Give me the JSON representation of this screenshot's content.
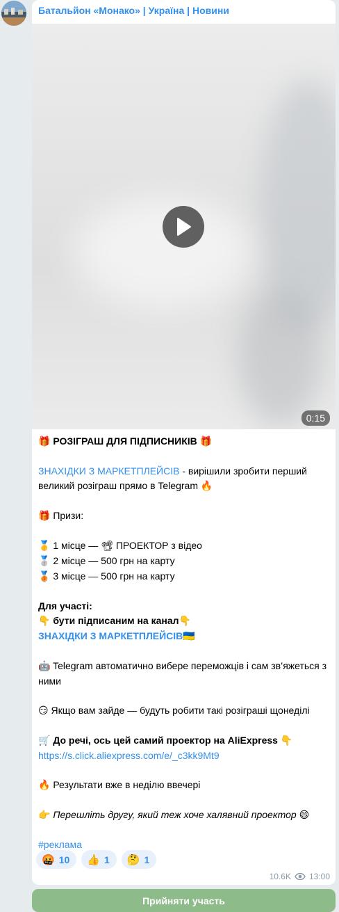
{
  "channel": {
    "title": "Батальйон «Монако» | Україна | Новини"
  },
  "video": {
    "duration": "0:15",
    "play_icon": "play-icon"
  },
  "post": {
    "heading": "РОЗІГРАШ ДЛЯ ПІДПИСНИКІВ",
    "heading_emoji": "🎁",
    "intro_link": "ЗНАХІДКИ З МАРКЕТПЛЕЙСІВ",
    "intro_text": " - вирішили зробити перший великий розіграш прямо в Telegram",
    "intro_emoji": "🔥",
    "prizes_emoji": "🎁",
    "prizes_label": "Призи:",
    "prize1_emoji": "🥇",
    "prize1_text": "1 місце —",
    "prize1_icon": "📽",
    "prize1_item": "ПРОЕКТОР з відео",
    "prize2_emoji": "🥈",
    "prize2_text": "2 місце — 500 грн на карту",
    "prize3_emoji": "🥉",
    "prize3_text": "3 місце — 500 грн на карту",
    "participation_label": "Для участі:",
    "participation_emoji": "👇",
    "participation_text": "бути підписаним на канал",
    "participation_emoji2": "👇",
    "channel_link": "ЗНАХІДКИ З МАРКЕТПЛЕЙСІВ",
    "flag_emoji": "🇺🇦",
    "bot_emoji": "🤖",
    "bot_text": "Telegram автоматично вибере переможців і сам зв’яжеться з ними",
    "smirk_emoji": "😏",
    "weekly_text": "Якщо вам зайде — будуть робити такі розіграші щонеділі",
    "cart_emoji": "🛒",
    "product_text": "До речі, ось цей самий проектор на AliExpress",
    "product_emoji2": "👇",
    "product_url": "https://s.click.aliexpress.com/e/_c3kk9Mt9",
    "results_emoji": "🔥",
    "results_text": "Результати вже в неділю ввечері",
    "share_emoji": "👉",
    "share_text": "Перешліть другу, який теж хоче халявний проектор",
    "share_emoji2": "😄",
    "hashtag": "#реклама"
  },
  "reactions": [
    {
      "emoji": "🤬",
      "count": "10"
    },
    {
      "emoji": "👍",
      "count": "1"
    },
    {
      "emoji": "🤔",
      "count": "1"
    }
  ],
  "meta": {
    "views": "10.6K",
    "views_icon": "eye-icon",
    "time": "13:00"
  },
  "join_button": {
    "label": "Прийняти участь"
  },
  "colors": {
    "link": "#3390ec",
    "button": "#8dbb8a",
    "background": "#e6ebee"
  }
}
